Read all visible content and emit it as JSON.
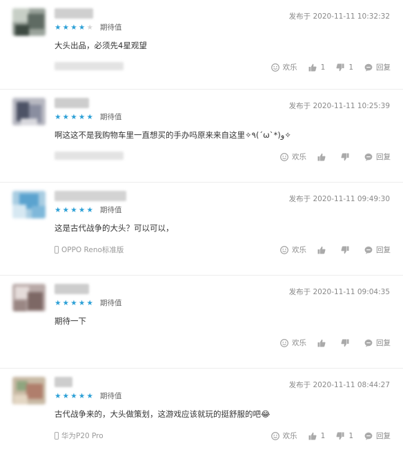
{
  "actions": {
    "fun": "欢乐",
    "reply": "回复"
  },
  "reviews": [
    {
      "date": "发布于 2020-11-11 10:32:32",
      "stars": 4,
      "rating_label": "期待值",
      "content": "大头出品，必须先4星观望",
      "device": "",
      "likes": "1",
      "dislikes": "1"
    },
    {
      "date": "发布于 2020-11-11 10:25:39",
      "stars": 5,
      "rating_label": "期待值",
      "content": "啊这这不是我购物车里一直想买的手办吗原来来自这里✧٩(ˊωˋ*)و✧",
      "device": "",
      "likes": "",
      "dislikes": ""
    },
    {
      "date": "发布于 2020-11-11 09:49:30",
      "stars": 5,
      "rating_label": "期待值",
      "content": "这是古代战争的大头？可以可以，",
      "device": "OPPO Reno标准版",
      "likes": "",
      "dislikes": ""
    },
    {
      "date": "发布于 2020-11-11 09:04:35",
      "stars": 5,
      "rating_label": "期待值",
      "content": "期待一下",
      "device": "",
      "likes": "",
      "dislikes": ""
    },
    {
      "date": "发布于 2020-11-11 08:44:27",
      "stars": 5,
      "rating_label": "期待值",
      "content": "古代战争来的，大头做策划，这游戏应该就玩的挺舒服的吧😂",
      "device": "华为P20 Pro",
      "likes": "1",
      "dislikes": "1"
    }
  ]
}
